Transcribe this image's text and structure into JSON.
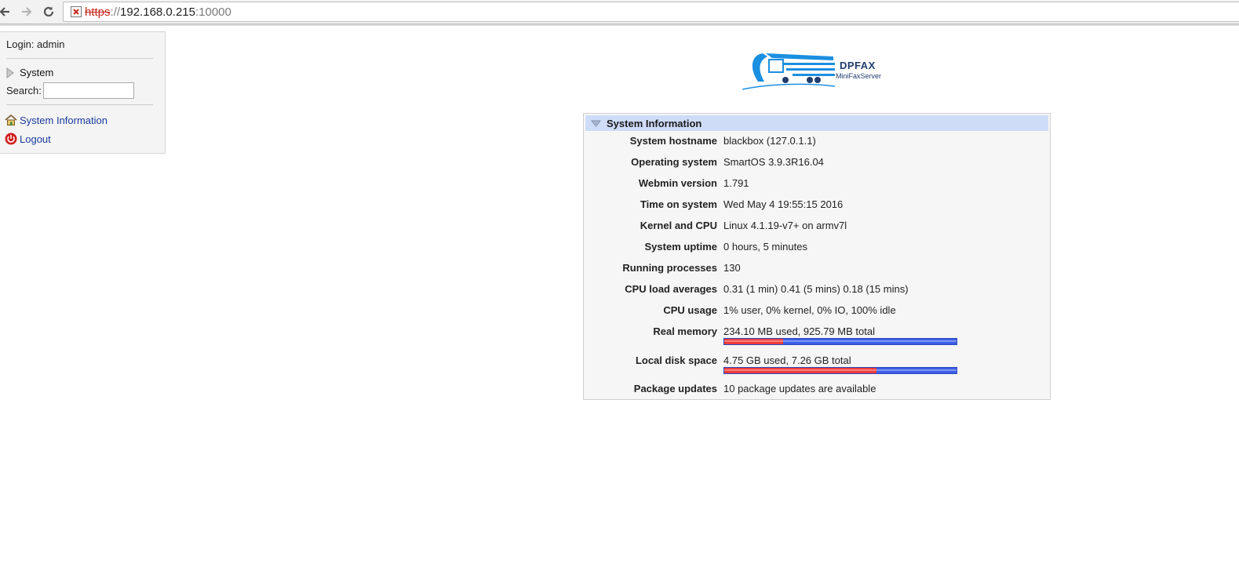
{
  "browser": {
    "url_scheme": "https",
    "url_sep": "://",
    "url_host": "192.168.0.215",
    "url_port": ":10000"
  },
  "sidebar": {
    "login": "Login: admin",
    "system_label": "System",
    "search_label": "Search:",
    "search_value": "",
    "links": [
      {
        "label": "System Information",
        "icon": "home-icon"
      },
      {
        "label": "Logout",
        "icon": "power-icon"
      }
    ]
  },
  "logo": {
    "brand": "DPFAX",
    "subtitle": "MiniFaxServer"
  },
  "panel": {
    "title": "System Information",
    "rows": [
      {
        "key": "System hostname",
        "value": "blackbox (127.0.1.1)"
      },
      {
        "key": "Operating system",
        "value": "SmartOS 3.9.3R16.04"
      },
      {
        "key": "Webmin version",
        "value": "1.791"
      },
      {
        "key": "Time on system",
        "value": "Wed May 4 19:55:15 2016"
      },
      {
        "key": "Kernel and CPU",
        "value": "Linux 4.1.19-v7+ on armv7l"
      },
      {
        "key": "System uptime",
        "value": "0 hours, 5 minutes"
      },
      {
        "key": "Running processes",
        "value": "130"
      },
      {
        "key": "CPU load averages",
        "value": "0.31 (1 min) 0.41 (5 mins) 0.18 (15 mins)"
      },
      {
        "key": "CPU usage",
        "value": "1% user, 0% kernel, 0% IO, 100% idle"
      },
      {
        "key": "Real memory",
        "value": "234.10 MB used, 925.79 MB total",
        "used_fraction": 0.253
      },
      {
        "key": "Local disk space",
        "value": "4.75 GB used, 7.26 GB total",
        "used_fraction": 0.654
      },
      {
        "key": "Package updates",
        "value": "10 package updates are available"
      }
    ]
  },
  "colors": {
    "bar_used": "#f03b3b",
    "bar_free": "#3b5ee6",
    "link": "#1a3a9c",
    "header_bg": "#cfdcf8"
  }
}
